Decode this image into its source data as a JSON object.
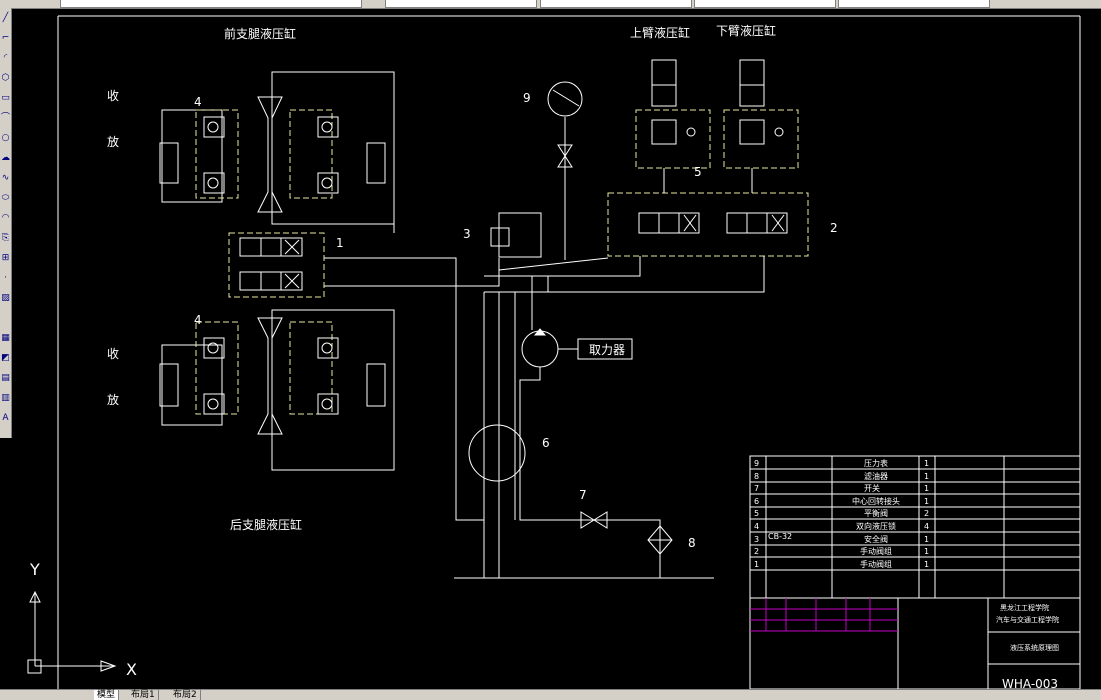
{
  "drawing": {
    "labels": {
      "front_cyl": "前支腿液压缸",
      "rear_cyl": "后支腿液压缸",
      "upper_arm": "上臂液压缸",
      "lower_arm": "下臂液压缸",
      "pto": "取力器",
      "collect": "收",
      "release": "放",
      "n1": "1",
      "n2": "2",
      "n3": "3",
      "n4": "4",
      "n5": "5",
      "n6": "6",
      "n7": "7",
      "n8": "8",
      "n9": "9"
    },
    "bom": {
      "rows": [
        {
          "no": "9",
          "name": "压力表",
          "qty": "1"
        },
        {
          "no": "8",
          "name": "滤油器",
          "qty": "1"
        },
        {
          "no": "7",
          "name": "开关",
          "qty": "1"
        },
        {
          "no": "6",
          "name": "中心回转接头",
          "qty": "1"
        },
        {
          "no": "5",
          "name": "平衡阀",
          "qty": "2"
        },
        {
          "no": "4",
          "name": "双向液压锁",
          "qty": "4"
        },
        {
          "no": "3",
          "name": "安全阀",
          "qty": "1"
        },
        {
          "no": "2",
          "name": "手动阀组",
          "qty": "1"
        },
        {
          "no": "1",
          "name": "手动阀组",
          "qty": "1"
        }
      ],
      "cb_code": "CB-32"
    },
    "title_block": {
      "school": "黑龙江工程学院",
      "dept": "汽车与交通工程学院",
      "drawing_title": "液压系统原理图",
      "drawing_number": "WHA-003"
    },
    "ucs": {
      "x": "X",
      "y": "Y"
    }
  },
  "tabs": [
    "模型",
    "布局1",
    "布局2"
  ]
}
